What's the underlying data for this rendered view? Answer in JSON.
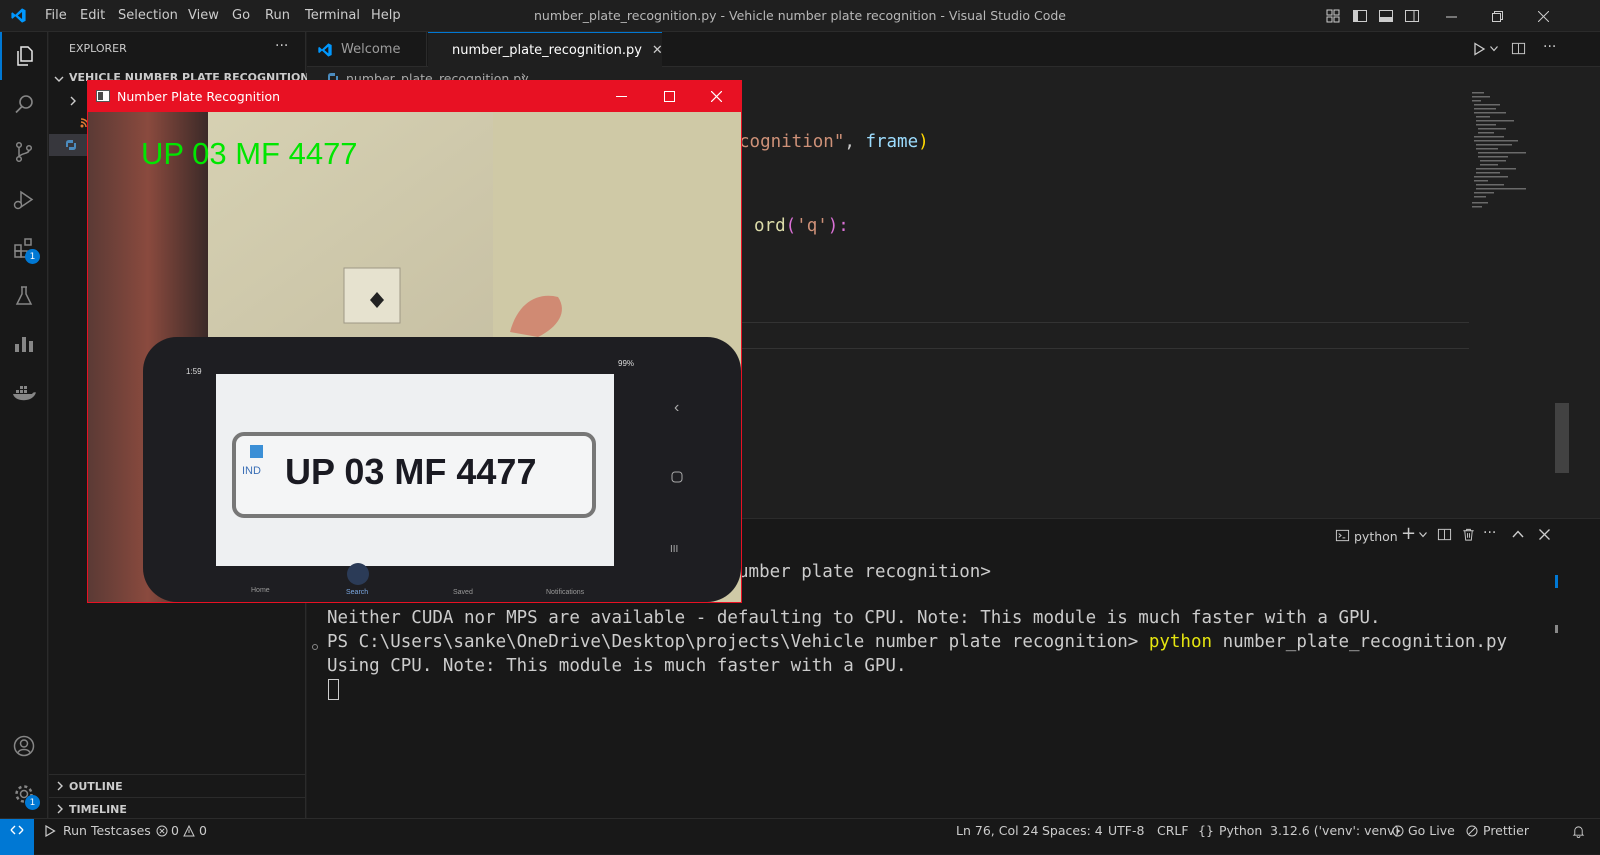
{
  "titlebar": {
    "menus": [
      "File",
      "Edit",
      "Selection",
      "View",
      "Go",
      "Run",
      "Terminal",
      "Help"
    ],
    "window_title": "number_plate_recognition.py - Vehicle number plate recognition - Visual Studio Code"
  },
  "activity_bar": {
    "extensions_badge": "1",
    "settings_badge": "1"
  },
  "sidebar": {
    "title": "EXPLORER",
    "more": "···",
    "folder": "VEHICLE NUMBER PLATE RECOGNITION",
    "outline": "OUTLINE",
    "timeline": "TIMELINE"
  },
  "tabs": {
    "welcome": "Welcome",
    "active": "number_plate_recognition.py",
    "close": "✕"
  },
  "breadcrumb": {
    "file": "number_plate_recognition.py",
    "sep": "›"
  },
  "editor": {
    "line1_str": "cognition\"",
    "line1_comma": ", ",
    "line1_var": "frame",
    "line1_paren": ")",
    "line2_fn": "ord",
    "line2_open": "(",
    "line2_str": "'q'",
    "line2_close": "):"
  },
  "panel": {
    "shell": "python",
    "lines": [
      "umber plate recognition>",
      "Neither CUDA nor MPS are available - defaulting to CPU. Note: This module is much faster with a GPU.",
      "PS C:\\Users\\sanke\\OneDrive\\Desktop\\projects\\Vehicle number plate recognition> ",
      "Using CPU. Note: This module is much faster with a GPU."
    ],
    "cmd_python": "python",
    "cmd_args": " number_plate_recognition.py"
  },
  "cv_window": {
    "title": "Number Plate Recognition",
    "overlay_text": "UP 03 MF 4477",
    "plate_text": "UP 03 MF 4477",
    "plate_country": "IND",
    "phone_status_time": "1:59",
    "phone_battery": "99%",
    "phone_nav": [
      "Home",
      "Search",
      "Saved",
      "Notifications"
    ]
  },
  "statusbar": {
    "run_testcases": "Run Testcases",
    "errors": "0",
    "warnings": "0",
    "position": "Ln 76, Col 24",
    "spaces": "Spaces: 4",
    "encoding": "UTF-8",
    "eol": "CRLF",
    "braces": "{}",
    "language": "Python",
    "interpreter": "3.12.6 ('venv': venv)",
    "golive": "Go Live",
    "prettier": "Prettier"
  },
  "colors": {
    "accent": "#0078d4",
    "cv_titlebar": "#e81123",
    "overlay_green": "#00e600"
  }
}
